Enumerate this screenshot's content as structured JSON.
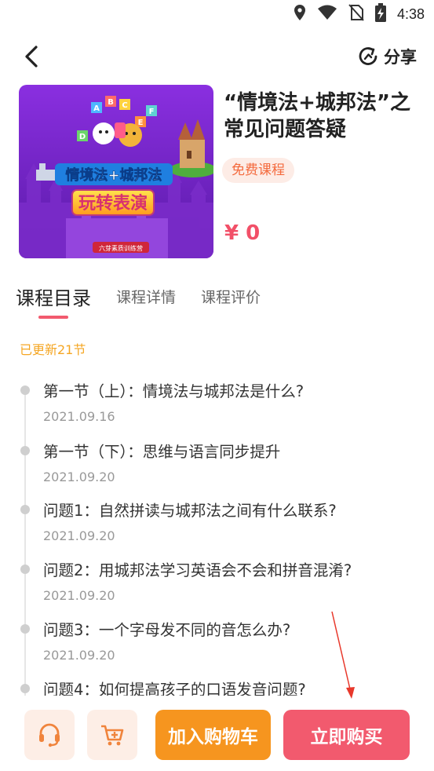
{
  "status_bar": {
    "time": "4:38",
    "icons": [
      "location-icon",
      "wifi-icon",
      "no-sim-icon",
      "battery-charging-icon"
    ]
  },
  "header": {
    "back_icon": "chevron-left-icon",
    "share_label": "分享",
    "share_icon": "share-refresh-icon"
  },
  "course": {
    "title": "“情境法+城邦法”之常见问题答疑",
    "tag": "免费课程",
    "price": "¥ 0",
    "cover": {
      "line1": "情境法+城邦法",
      "line2": "玩转表演",
      "footer": "六芽素质训练营",
      "blocks": [
        "A",
        "B",
        "C",
        "D",
        "E",
        "F"
      ]
    }
  },
  "tabs": [
    {
      "label": "课程目录",
      "active": true
    },
    {
      "label": "课程详情",
      "active": false
    },
    {
      "label": "课程评价",
      "active": false
    }
  ],
  "update_count": "已更新21节",
  "lessons": [
    {
      "title": "第一节（上）：情境法与城邦法是什么?",
      "date": "2021.09.16"
    },
    {
      "title": "第一节（下）：思维与语言同步提升",
      "date": "2021.09.20"
    },
    {
      "title": "问题1：自然拼读与城邦法之间有什么联系?",
      "date": "2021.09.20"
    },
    {
      "title": "问题2：用城邦法学习英语会不会和拼音混淆?",
      "date": "2021.09.20"
    },
    {
      "title": "问题3：一个字母发不同的音怎么办?",
      "date": "2021.09.20"
    },
    {
      "title": "问题4：如何提高孩子的口语发音问题?",
      "date": ""
    }
  ],
  "bottom_bar": {
    "customer_service_icon": "headset-icon",
    "cart_icon": "shopping-cart-icon",
    "add_to_cart_label": "加入购物车",
    "buy_now_label": "立即购买"
  },
  "colors": {
    "accent_red": "#f25a6e",
    "accent_orange": "#f6951f",
    "price_red": "#f25068",
    "update_text": "#f5a623",
    "icon_orange": "#f0843c",
    "tag_bg": "#fdece6"
  }
}
